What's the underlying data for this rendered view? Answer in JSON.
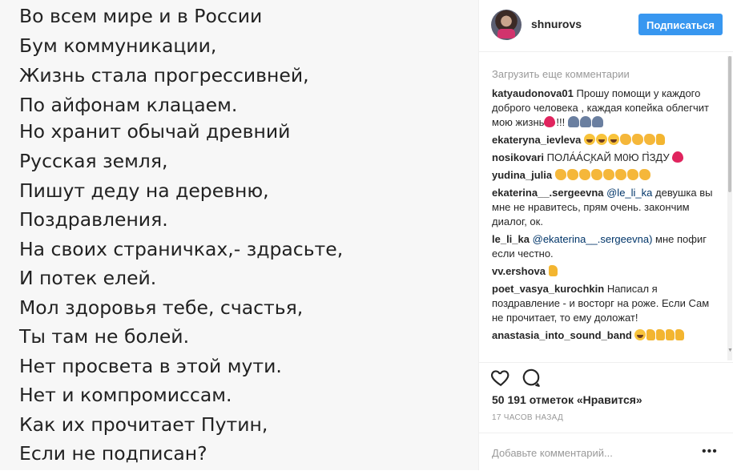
{
  "poem": [
    "Во всем мире и в России",
    "Бум коммуникации,",
    "Жизнь стала прогрессивней,",
    "По айфонам клацаем.",
    "Но хранит обычай древний",
    "Русская земля,",
    "Пишут деду на деревню,",
    "Поздравления.",
    "На своих страничках,- здрасьте,",
    "И потек елей.",
    "Мол здоровья тебе, счастья,",
    "Ты там не болей.",
    "Нет просвета в этой мути.",
    "Нет и компромиссам.",
    "Как их прочитает Путин,",
    "Если не подписан?"
  ],
  "header": {
    "username": "shnurovs",
    "follow_label": "Подписаться"
  },
  "load_more": "Загрузить еще комментарии",
  "comments": [
    {
      "author": "katyaudonova01",
      "text": "Прошу помощи у каждого доброго человека , каждая копейка облегчит мою жизнь",
      "tail": "!!!"
    },
    {
      "author": "ekateryna_ievleva",
      "text": ""
    },
    {
      "author": "nosikovari",
      "text": "ПОЛА́А́С̧КАЙ М0Ю П̀ЗДУ"
    },
    {
      "author": "yudina_julia",
      "text": ""
    },
    {
      "author": "ekaterina__.sergeevna",
      "mention": "@le_li_ka",
      "text": "девушка вы мне не нравитесь, прям очень. закончим диалог, ок."
    },
    {
      "author": "le_li_ka",
      "mention": "@ekaterina__.sergeevna)",
      "text": "мне пофиг если честно."
    },
    {
      "author": "vv.ershova",
      "text": ""
    },
    {
      "author": "poet_vasya_kurochkin",
      "text": "Написал я поздравление - и восторг на роже. Если Сам не прочитает, то ему доложат!"
    },
    {
      "author": "anastasia_into_sound_band",
      "text": ""
    }
  ],
  "likes": "50 191 отметок «Нравится»",
  "time": "17 ЧАСОВ НАЗАД",
  "add_comment_placeholder": "Добавьте комментарий...",
  "icons": [
    "heart-icon",
    "comment-icon",
    "more-icon"
  ],
  "colors": {
    "accent": "#3897f0",
    "text": "#262626",
    "muted": "#999999",
    "image_bg": "#f7f7f7"
  }
}
